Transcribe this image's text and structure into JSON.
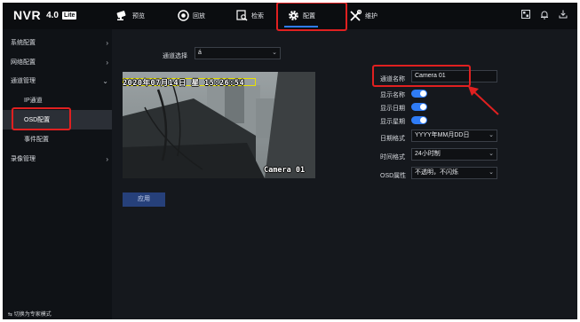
{
  "brand": {
    "name": "NVR",
    "version": "4.0",
    "edition": "Lite"
  },
  "nav": {
    "items": [
      {
        "label": "预览",
        "icon": "camera-icon"
      },
      {
        "label": "回放",
        "icon": "playback-icon"
      },
      {
        "label": "检索",
        "icon": "search-icon"
      },
      {
        "label": "配置",
        "icon": "gear-icon",
        "active": true
      },
      {
        "label": "维护",
        "icon": "wrench-icon"
      }
    ],
    "right_icons": [
      "qr-code-icon",
      "bell-icon",
      "download-icon",
      "power-icon"
    ]
  },
  "sidebar": {
    "items": [
      {
        "label": "系统配置",
        "chevron": "›"
      },
      {
        "label": "网络配置",
        "chevron": "›"
      },
      {
        "label": "通道管理",
        "chevron": "⌄"
      },
      {
        "label": "IP通道"
      },
      {
        "label": "OSD配置",
        "active": true
      },
      {
        "label": "事件配置"
      },
      {
        "label": "录像管理",
        "chevron": "›"
      }
    ],
    "footer": "⇆ 切换为专家模式"
  },
  "main": {
    "channel_select": {
      "label": "通道选择",
      "value": "á"
    },
    "video": {
      "datetime_overlay": "2020年07月14日 星 15:26:54",
      "name_overlay": "Camera 01"
    },
    "apply_label": "应用",
    "settings": {
      "channel_name": {
        "label": "通道名称",
        "value": "Camera 01"
      },
      "show_name": {
        "label": "显示名称",
        "on": true
      },
      "show_date": {
        "label": "显示日期",
        "on": true
      },
      "show_week": {
        "label": "显示星期",
        "on": true
      },
      "date_format": {
        "label": "日期格式",
        "value": "YYYY年MM月DD日"
      },
      "time_format": {
        "label": "时间格式",
        "value": "24小时制"
      },
      "osd_attr": {
        "label": "OSD属性",
        "value": "不透明，不闪烁"
      }
    }
  },
  "colors": {
    "accent": "#2f7cf6",
    "annotation": "#e02020",
    "osd_frame": "#e8e000"
  }
}
